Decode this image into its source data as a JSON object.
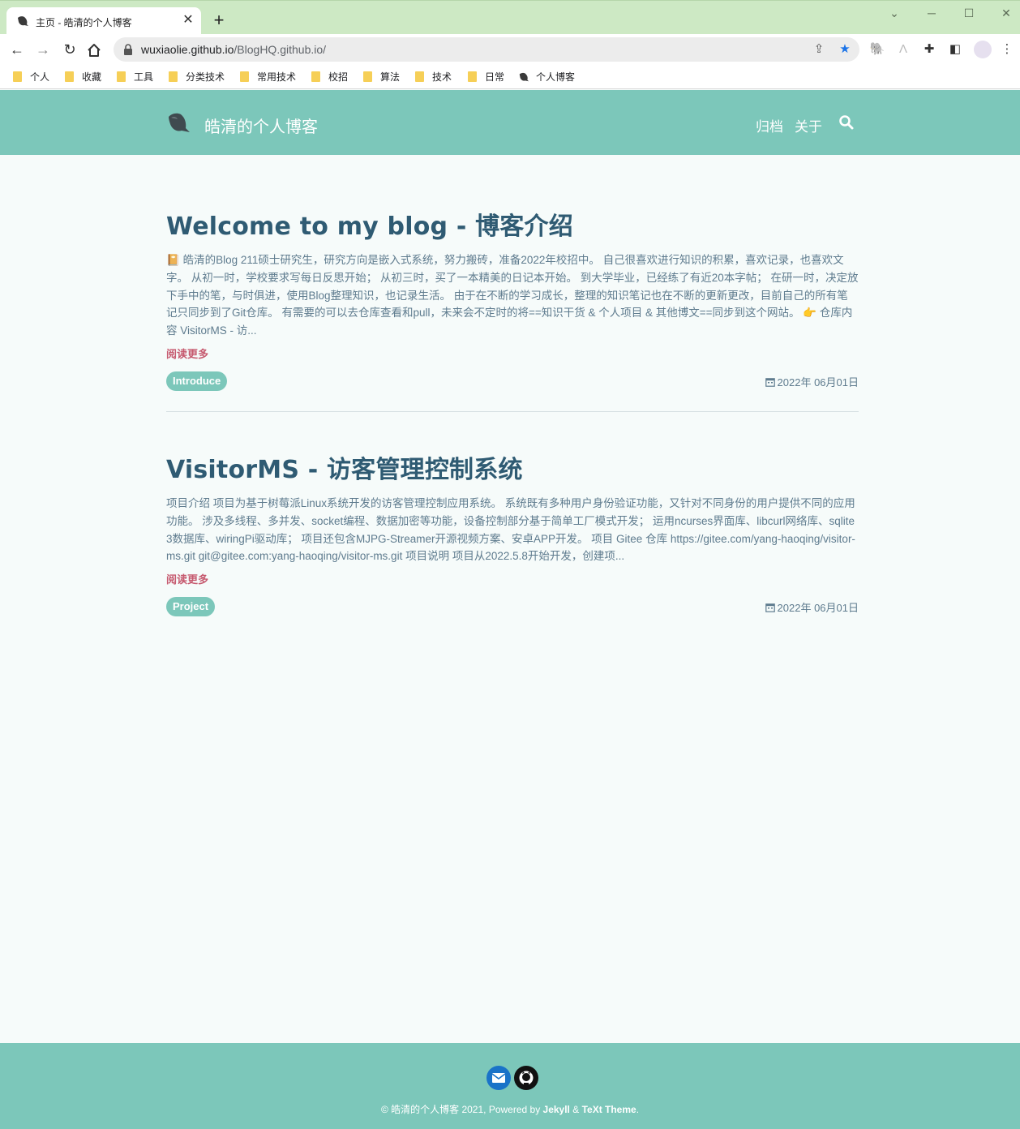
{
  "browser": {
    "tab_title": "主页 - 皓清的个人博客",
    "url_host": "wuxiaolie.github.io",
    "url_path": "/BlogHQ.github.io/",
    "bookmarks": [
      "个人",
      "收藏",
      "工具",
      "分类技术",
      "常用技术",
      "校招",
      "算法",
      "技术",
      "日常",
      "个人博客"
    ]
  },
  "site": {
    "title": "皓清的个人博客",
    "nav": [
      "归档",
      "关于"
    ]
  },
  "posts": [
    {
      "title": "Welcome to my blog - 博客介绍",
      "excerpt": "皓清的Blog 211硕士研究生，研究方向是嵌入式系统，努力搬砖，准备2022年校招中。 自己很喜欢进行知识的积累，喜欢记录，也喜欢文字。 从初一时，学校要求写每日反思开始； 从初三时，买了一本精美的日记本开始。 到大学毕业，已经练了有近20本字帖； 在研一时，决定放下手中的笔，与时俱进，使用Blog整理知识，也记录生活。 由于在不断的学习成长，整理的知识笔记也在不断的更新更改，目前自己的所有笔记只同步到了Git仓库。 有需要的可以去仓库查看和pull，未来会不定时的将==知识干货 & 个人项目 & 其他博文==同步到这个网站。",
      "excerpt_tail": "仓库内容 VisitorMS - 访...",
      "read_more": "阅读更多",
      "tag": "Introduce",
      "date": "2022年 06月01日"
    },
    {
      "title": "VisitorMS - 访客管理控制系统",
      "excerpt": "项目介绍 项目为基于树莓派Linux系统开发的访客管理控制应用系统。 系统既有多种用户身份验证功能，又针对不同身份的用户提供不同的应用功能。 涉及多线程、多并发、socket编程、数据加密等功能，设备控制部分基于简单工厂模式开发； 运用ncurses界面库、libcurl网络库、sqlite3数据库、wiringPi驱动库； 项目还包含MJPG-Streamer开源视频方案、安卓APP开发。 项目 Gitee 仓库 https://gitee.com/yang-haoqing/visitor-ms.git git@gitee.com:yang-haoqing/visitor-ms.git 项目说明 项目从2022.5.8开始开发，创建项...",
      "read_more": "阅读更多",
      "tag": "Project",
      "date": "2022年 06月01日"
    }
  ],
  "footer": {
    "copyright_prefix": "© 皓清的个人博客 2021, Powered by ",
    "jekyll": "Jekyll",
    "amp": " & ",
    "theme": "TeXt Theme",
    "suffix": "."
  },
  "colors": {
    "accent": "#7cc7ba",
    "title": "#2f5b73",
    "read_more": "#c65a6f",
    "tabstrip": "#cde9c4"
  }
}
